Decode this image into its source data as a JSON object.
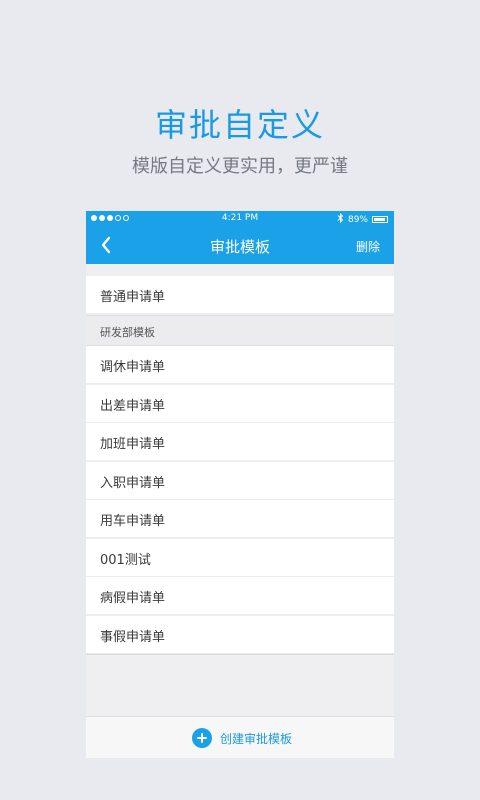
{
  "headline": "审批自定义",
  "subline": "模版自定义更实用，更严谨",
  "status_bar": {
    "time": "4:21 PM",
    "battery_text": "89%",
    "battery_level": 0.89,
    "signal_dots_filled": 3,
    "icons": [
      "signal-dots-icon",
      "bluetooth-icon",
      "battery-icon"
    ]
  },
  "nav": {
    "title": "审批模板",
    "delete_label": "删除",
    "back_icon": "chevron-left-icon"
  },
  "list": {
    "top_item": "普通申请单",
    "section_header": "研发部模板",
    "items": [
      "调休申请单",
      "出差申请单",
      "加班申请单",
      "入职申请单",
      "用车申请单",
      "001测试",
      "病假申请单",
      "事假申请单"
    ]
  },
  "footer": {
    "create_label": "创建审批模板",
    "create_icon": "plus-circle-icon"
  },
  "colors": {
    "accent": "#1aa1e8",
    "background": "#e9eaf0"
  }
}
